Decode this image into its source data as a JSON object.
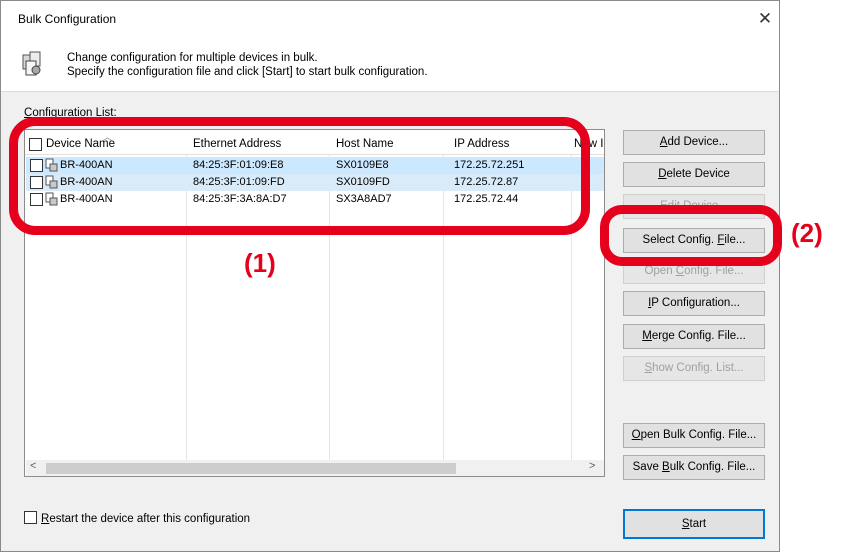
{
  "window": {
    "title": "Bulk Configuration",
    "close_glyph": "✕"
  },
  "header": {
    "icon": "devices-config-icon",
    "line1": "Change configuration for multiple devices in bulk.",
    "line2": "Specify the configuration file and click [Start] to start bulk configuration."
  },
  "list": {
    "label_accel": "C",
    "label_rest": "onfiguration List:",
    "columns": [
      "Device Name",
      "Ethernet Address",
      "Host Name",
      "IP Address",
      "New I"
    ],
    "rows": [
      {
        "checked": false,
        "device": "BR-400AN",
        "ethernet": "84:25:3F:01:09:E8",
        "host": "SX0109E8",
        "ip": "172.25.72.251",
        "state": "selected"
      },
      {
        "checked": false,
        "device": "BR-400AN",
        "ethernet": "84:25:3F:01:09:FD",
        "host": "SX0109FD",
        "ip": "172.25.72.87",
        "state": "selected"
      },
      {
        "checked": false,
        "device": "BR-400AN",
        "ethernet": "84:25:3F:3A:8A:D7",
        "host": "SX3A8AD7",
        "ip": "172.25.72.44",
        "state": "normal"
      }
    ],
    "scroll_left": "<",
    "scroll_right": ">"
  },
  "buttons": {
    "add_device": {
      "accel": "A",
      "rest": "dd Device..."
    },
    "delete_device": {
      "accel": "D",
      "rest": "elete Device"
    },
    "edit_device": {
      "pre": "",
      "accel": "E",
      "rest": "dit Device..."
    },
    "select_config": {
      "pre": "Select Config. ",
      "accel": "F",
      "rest": "ile..."
    },
    "open_config": {
      "pre": "Open ",
      "accel": "C",
      "rest": "onfig. File..."
    },
    "ip_config": {
      "accel": "I",
      "rest": "P Configuration..."
    },
    "merge_config": {
      "accel": "M",
      "rest": "erge Config. File..."
    },
    "show_config": {
      "pre": "",
      "accel": "S",
      "rest": "how Config. List..."
    },
    "open_bulk": {
      "accel": "O",
      "rest": "pen Bulk Config. File..."
    },
    "save_bulk": {
      "pre": "Save ",
      "accel": "B",
      "rest": "ulk Config. File..."
    },
    "start": {
      "accel": "S",
      "rest": "tart"
    }
  },
  "restart": {
    "checked": false,
    "accel": "R",
    "rest": "estart the device after this configuration"
  },
  "annotations": {
    "label1": "(1)",
    "label2": "(2)",
    "color": "#e5001c"
  }
}
